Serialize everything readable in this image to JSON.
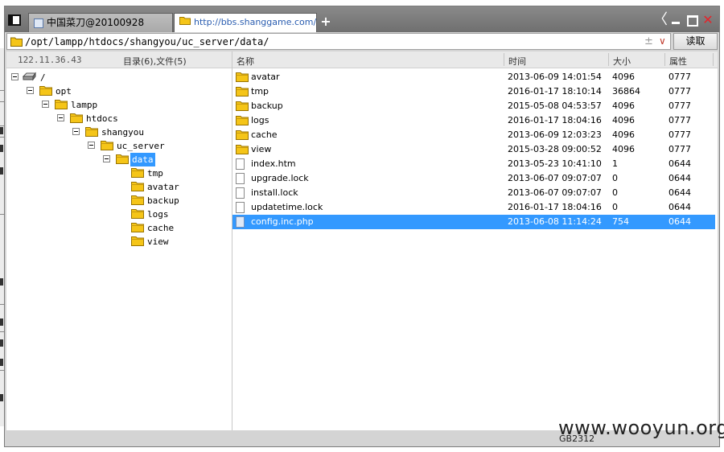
{
  "tabs": [
    {
      "label": "中国菜刀@20100928",
      "active": false
    },
    {
      "label": "http://bbs.shanggame.com/s...",
      "active": true
    }
  ],
  "newtab": "+",
  "window_controls": {
    "back": "〈",
    "close": "✕"
  },
  "address": {
    "path": "/opt/lampp/htdocs/shangyou/uc_server/data/",
    "plusminus": "±",
    "dropdown": "∨"
  },
  "read_button": "读取",
  "left_header": {
    "ip": "122.11.36.43",
    "counts": "目录(6),文件(5)"
  },
  "columns": {
    "name": "名称",
    "time": "时间",
    "size": "大小",
    "perm": "属性"
  },
  "tree": [
    {
      "label": "/",
      "depth": 0,
      "type": "drive",
      "expanded": true
    },
    {
      "label": "opt",
      "depth": 1,
      "type": "folder",
      "expanded": true
    },
    {
      "label": "lampp",
      "depth": 2,
      "type": "folder",
      "expanded": true
    },
    {
      "label": "htdocs",
      "depth": 3,
      "type": "folder",
      "expanded": true
    },
    {
      "label": "shangyou",
      "depth": 4,
      "type": "folder",
      "expanded": true
    },
    {
      "label": "uc_server",
      "depth": 5,
      "type": "folder",
      "expanded": true
    },
    {
      "label": "data",
      "depth": 6,
      "type": "folder",
      "expanded": true,
      "selected": true
    },
    {
      "label": "tmp",
      "depth": 7,
      "type": "folder"
    },
    {
      "label": "avatar",
      "depth": 7,
      "type": "folder"
    },
    {
      "label": "backup",
      "depth": 7,
      "type": "folder"
    },
    {
      "label": "logs",
      "depth": 7,
      "type": "folder"
    },
    {
      "label": "cache",
      "depth": 7,
      "type": "folder"
    },
    {
      "label": "view",
      "depth": 7,
      "type": "folder"
    }
  ],
  "files": [
    {
      "name": "avatar",
      "time": "2013-06-09 14:01:54",
      "size": "4096",
      "perm": "0777",
      "type": "folder"
    },
    {
      "name": "tmp",
      "time": "2016-01-17 18:10:14",
      "size": "36864",
      "perm": "0777",
      "type": "folder"
    },
    {
      "name": "backup",
      "time": "2015-05-08 04:53:57",
      "size": "4096",
      "perm": "0777",
      "type": "folder"
    },
    {
      "name": "logs",
      "time": "2016-01-17 18:04:16",
      "size": "4096",
      "perm": "0777",
      "type": "folder"
    },
    {
      "name": "cache",
      "time": "2013-06-09 12:03:23",
      "size": "4096",
      "perm": "0777",
      "type": "folder"
    },
    {
      "name": "view",
      "time": "2015-03-28 09:00:52",
      "size": "4096",
      "perm": "0777",
      "type": "folder"
    },
    {
      "name": "index.htm",
      "time": "2013-05-23 10:41:10",
      "size": "1",
      "perm": "0644",
      "type": "file"
    },
    {
      "name": "upgrade.lock",
      "time": "2013-06-07 09:07:07",
      "size": "0",
      "perm": "0644",
      "type": "file"
    },
    {
      "name": "install.lock",
      "time": "2013-06-07 09:07:07",
      "size": "0",
      "perm": "0644",
      "type": "file"
    },
    {
      "name": "updatetime.lock",
      "time": "2016-01-17 18:04:16",
      "size": "0",
      "perm": "0644",
      "type": "file"
    },
    {
      "name": "config.inc.php",
      "time": "2013-06-08 11:14:24",
      "size": "754",
      "perm": "0644",
      "type": "php",
      "selected": true
    }
  ],
  "status": {
    "encoding": "GB2312"
  },
  "watermark": "www.wooyun.org",
  "colors": {
    "selection": "#3399ff",
    "folder": "#f5c518",
    "titlebar": "#7a7a7a",
    "close": "#e5242b",
    "link": "#2a5db0"
  }
}
